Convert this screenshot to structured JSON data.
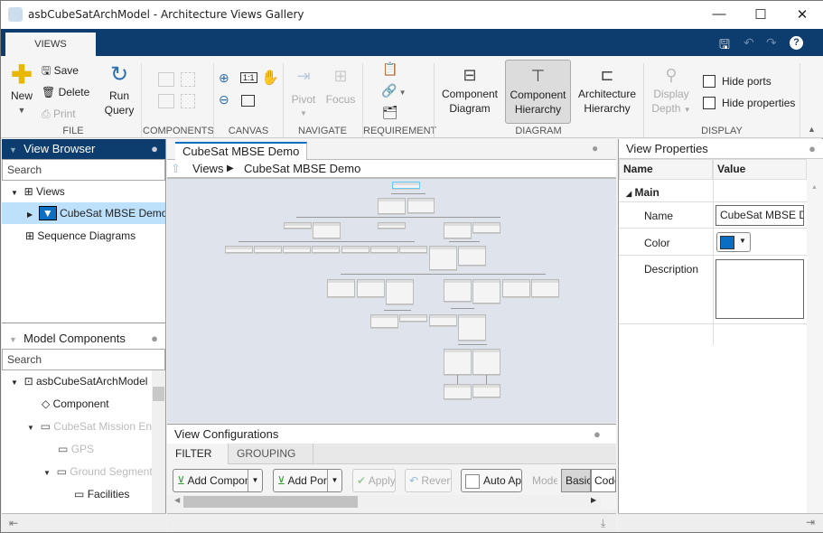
{
  "window": {
    "title": "asbCubeSatArchModel - Architecture Views Gallery",
    "minimize": "—",
    "maximize": "☐",
    "close": "✕"
  },
  "ribbon": {
    "tab": "VIEWS",
    "file": {
      "new": "New",
      "save": "Save",
      "delete": "Delete",
      "print": "Print",
      "run": "Run",
      "query": "Query",
      "group": "FILE"
    },
    "components": {
      "group": "COMPONENTS"
    },
    "canvas": {
      "group": "CANVAS",
      "fit": "1:1"
    },
    "navigate": {
      "pivot": "Pivot",
      "focus": "Focus",
      "group": "NAVIGATE"
    },
    "requirement": {
      "group": "REQUIREMENT"
    },
    "diagram": {
      "group": "DIAGRAM",
      "items": [
        {
          "l1": "Component",
          "l2": "Diagram"
        },
        {
          "l1": "Component",
          "l2": "Hierarchy",
          "selected": true
        },
        {
          "l1": "Architecture",
          "l2": "Hierarchy"
        }
      ]
    },
    "display": {
      "group": "DISPLAY",
      "depth1": "Display",
      "depth2": "Depth",
      "hide_ports": "Hide ports",
      "hide_properties": "Hide properties"
    }
  },
  "view_browser": {
    "title": "View Browser",
    "search_placeholder": "Search",
    "items": [
      {
        "label": "Views"
      },
      {
        "label": "CubeSat MBSE Demo",
        "selected": true
      },
      {
        "label": "Sequence Diagrams"
      }
    ]
  },
  "model_components": {
    "title": "Model Components",
    "search_placeholder": "Search",
    "items": [
      {
        "label": "asbCubeSatArchModel",
        "level": 0,
        "expanded": true
      },
      {
        "label": "Component",
        "level": 1
      },
      {
        "label": "CubeSat Mission Enterprise",
        "level": 1,
        "expanded": true,
        "dim": true
      },
      {
        "label": "GPS",
        "level": 2,
        "dim": true
      },
      {
        "label": "Ground Segment",
        "level": 2,
        "expanded": true,
        "dim": true
      },
      {
        "label": "Facilities",
        "level": 3
      }
    ]
  },
  "editor": {
    "tab": "CubeSat MBSE Demo",
    "breadcrumb": [
      "Views",
      "CubeSat MBSE Demo"
    ]
  },
  "view_config": {
    "title": "View Configurations",
    "tabs": [
      "FILTER",
      "GROUPING"
    ],
    "active_tab": "FILTER",
    "buttons": {
      "add_comp": "Add Component Filter",
      "add_port": "Add Port Filter",
      "apply": "Apply",
      "revert": "Revert",
      "auto": "Auto Apply",
      "mode": "Mode",
      "basic": "Basic",
      "code": "Code"
    }
  },
  "properties": {
    "title": "View Properties",
    "col_name": "Name",
    "col_value": "Value",
    "section": "Main",
    "rows": [
      {
        "name": "Name",
        "value": "CubeSat MBSE Demo"
      },
      {
        "name": "Color",
        "value": "#0a6fc2"
      },
      {
        "name": "Description",
        "value": ""
      }
    ]
  }
}
